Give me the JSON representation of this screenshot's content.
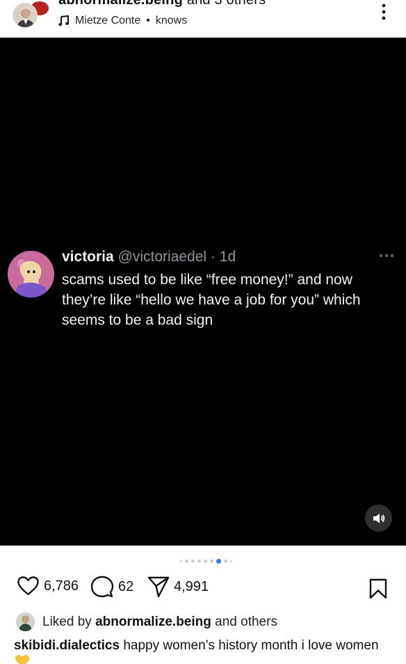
{
  "header": {
    "title_user": "abnormalize.being",
    "title_rest": " and 3 others",
    "audio_artist": "Mietze Conte",
    "audio_separator": "•",
    "audio_title": "knows"
  },
  "tweet": {
    "name": "victoria",
    "handle": "@victoriaedel",
    "time": "· 1d",
    "text": "scams used to be like “free money!” and now they’re like “hello we have a job for you” which seems to be a bad sign"
  },
  "carousel": {
    "total": 9,
    "active_index": 6
  },
  "actions": {
    "likes": "6,786",
    "comments": "62",
    "shares": "4,991"
  },
  "liked_by": {
    "prefix": "Liked by",
    "user": "abnormalize.being",
    "suffix": "and others"
  },
  "caption": {
    "user": "skibidi.dialectics",
    "text": "happy women’s history month i love women"
  },
  "colors": {
    "media_bg": "#000000",
    "handle_gray": "#8f969c",
    "active_dot": "#2e7fe0",
    "emoji_yellow": "#f5c33b"
  }
}
